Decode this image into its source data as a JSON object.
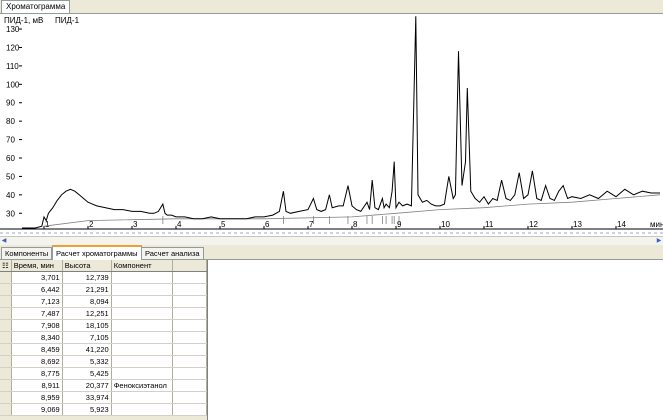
{
  "window": {
    "tab_title": "Хроматограмма"
  },
  "plot": {
    "channel_label": "ПИД-1, мВ",
    "channel_name": "ПИД-1",
    "x_unit": "мин",
    "y_ticks": [
      "130",
      "120",
      "110",
      "100",
      "90",
      "80",
      "70",
      "60",
      "50",
      "40",
      "30"
    ],
    "x_ticks": [
      "1",
      "2",
      "3",
      "4",
      "5",
      "6",
      "7",
      "8",
      "9",
      "10",
      "11",
      "12",
      "13",
      "14"
    ],
    "line_color": "#000000",
    "baseline_color": "#808080"
  },
  "chart_data": {
    "type": "line",
    "title": "",
    "xlabel": "мин",
    "ylabel": "ПИД-1, мВ",
    "xlim": [
      0.5,
      15.0
    ],
    "ylim": [
      22,
      136
    ],
    "grid": false,
    "series": [
      {
        "name": "ПИД-1",
        "x": [
          0.5,
          0.8,
          0.95,
          1.0,
          1.05,
          1.1,
          1.2,
          1.3,
          1.4,
          1.5,
          1.6,
          1.7,
          1.8,
          1.9,
          2.0,
          2.1,
          2.2,
          2.4,
          2.6,
          2.8,
          3.0,
          3.2,
          3.4,
          3.5,
          3.6,
          3.701,
          3.75,
          3.8,
          3.9,
          4.0,
          4.2,
          4.4,
          4.6,
          4.8,
          5.0,
          5.2,
          5.4,
          5.6,
          5.8,
          6.0,
          6.2,
          6.35,
          6.442,
          6.5,
          6.6,
          6.8,
          7.0,
          7.123,
          7.2,
          7.3,
          7.4,
          7.487,
          7.55,
          7.7,
          7.8,
          7.908,
          8.0,
          8.1,
          8.2,
          8.34,
          8.4,
          8.459,
          8.52,
          8.6,
          8.692,
          8.73,
          8.775,
          8.85,
          8.911,
          8.959,
          9.0,
          9.069,
          9.15,
          9.25,
          9.35,
          9.4,
          9.45,
          9.5,
          9.6,
          9.7,
          9.8,
          9.9,
          10.0,
          10.1,
          10.2,
          10.3,
          10.35,
          10.42,
          10.5,
          10.58,
          10.62,
          10.7,
          10.8,
          10.9,
          11.0,
          11.1,
          11.2,
          11.3,
          11.4,
          11.5,
          11.6,
          11.7,
          11.8,
          11.9,
          12.0,
          12.1,
          12.2,
          12.3,
          12.4,
          12.5,
          12.6,
          12.7,
          12.8,
          12.9,
          13.0,
          13.2,
          13.4,
          13.6,
          13.8,
          14.0,
          14.2,
          14.4,
          14.6,
          14.8,
          15.0
        ],
        "values": [
          22,
          22,
          23,
          28,
          26,
          30,
          33,
          37,
          40,
          42,
          43,
          42,
          40,
          38,
          36,
          35,
          34,
          33,
          32,
          32,
          31,
          31,
          30,
          30,
          31,
          35,
          30,
          29,
          29,
          28,
          28,
          27,
          27,
          28,
          27,
          27,
          27,
          27,
          28,
          28,
          29,
          31,
          42,
          31,
          30,
          31,
          32,
          38,
          32,
          31,
          32,
          40,
          33,
          34,
          34,
          45,
          34,
          32,
          31,
          36,
          32,
          48,
          33,
          32,
          38,
          33,
          35,
          33,
          42,
          58,
          33,
          36,
          34,
          35,
          34,
          85,
          137,
          40,
          36,
          37,
          35,
          34,
          34,
          35,
          50,
          38,
          40,
          118,
          45,
          58,
          98,
          42,
          38,
          36,
          39,
          35,
          38,
          37,
          48,
          38,
          37,
          40,
          52,
          38,
          40,
          53,
          38,
          37,
          45,
          38,
          37,
          42,
          45,
          38,
          39,
          38,
          40,
          38,
          42,
          39,
          43,
          40,
          42,
          41,
          41
        ]
      },
      {
        "name": "",
        "x": [
          1.0,
          2.0,
          4.0,
          6.0,
          8.0,
          9.0,
          10.0,
          11.0,
          12.0,
          13.0,
          14.0,
          15.0
        ],
        "values": [
          23,
          26,
          27,
          27,
          28,
          30,
          32,
          33,
          35,
          36,
          38,
          40
        ]
      }
    ]
  },
  "bottom_tabs": [
    "Компоненты",
    "Расчет хроматограммы",
    "Расчет анализа"
  ],
  "active_bottom_tab": 1,
  "table": {
    "columns": [
      "Время, мин",
      "Высота",
      "Компонент"
    ],
    "rows": [
      {
        "time": "3,701",
        "height": "12,739",
        "component": ""
      },
      {
        "time": "6,442",
        "height": "21,291",
        "component": ""
      },
      {
        "time": "7,123",
        "height": "8,094",
        "component": ""
      },
      {
        "time": "7,487",
        "height": "12,251",
        "component": ""
      },
      {
        "time": "7,908",
        "height": "18,105",
        "component": ""
      },
      {
        "time": "8,340",
        "height": "7,105",
        "component": ""
      },
      {
        "time": "8,459",
        "height": "41,220",
        "component": ""
      },
      {
        "time": "8,692",
        "height": "5,332",
        "component": ""
      },
      {
        "time": "8,775",
        "height": "5,425",
        "component": ""
      },
      {
        "time": "8,911",
        "height": "20,377",
        "component": "Феноксиэтанол"
      },
      {
        "time": "8,959",
        "height": "33,974",
        "component": ""
      },
      {
        "time": "9,069",
        "height": "5,923",
        "component": ""
      }
    ]
  }
}
